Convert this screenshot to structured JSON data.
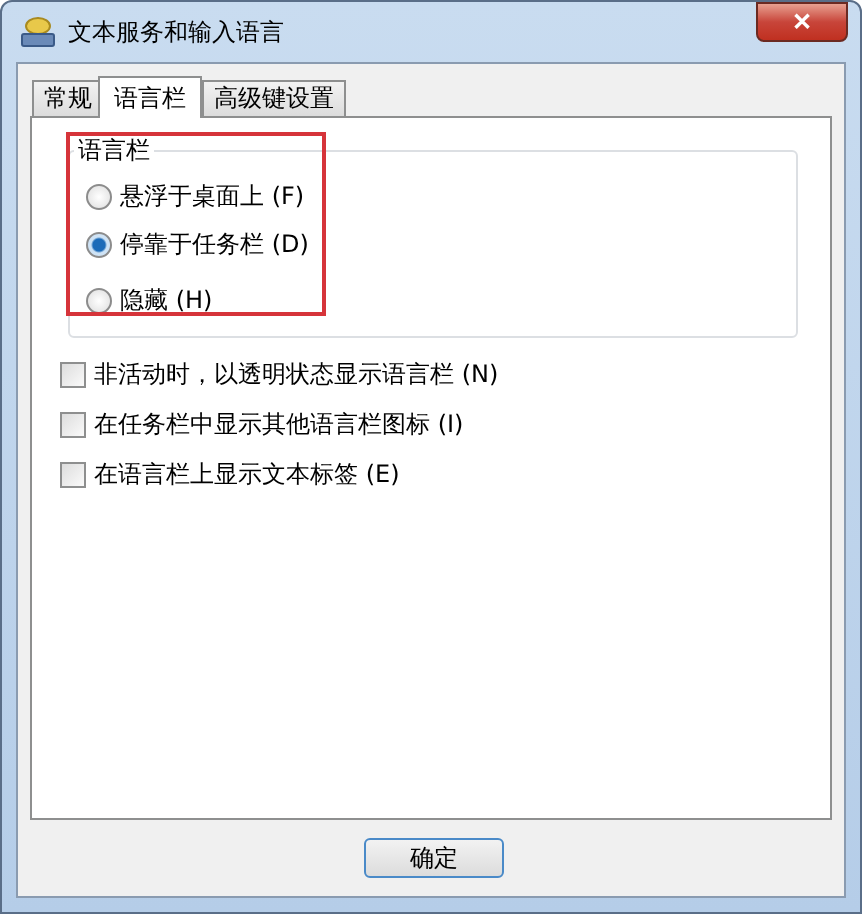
{
  "window": {
    "title": "文本服务和输入语言",
    "close_label": "✕"
  },
  "tabs": [
    {
      "label": "常规",
      "selected": false
    },
    {
      "label": "语言栏",
      "selected": true
    },
    {
      "label": "高级键设置",
      "selected": false
    }
  ],
  "group": {
    "title": "语言栏",
    "highlighted": true,
    "options": [
      {
        "label": "悬浮于桌面上 (F)",
        "selected": false
      },
      {
        "label": "停靠于任务栏 (D)",
        "selected": true
      },
      {
        "label": "隐藏 (H)",
        "selected": false
      }
    ]
  },
  "checkboxes": [
    {
      "label": "非活动时，以透明状态显示语言栏 (N)",
      "checked": false
    },
    {
      "label": "在任务栏中显示其他语言栏图标 (I)",
      "checked": false
    },
    {
      "label": "在语言栏上显示文本标签 (E)",
      "checked": false
    }
  ],
  "buttons": [
    "确定"
  ]
}
